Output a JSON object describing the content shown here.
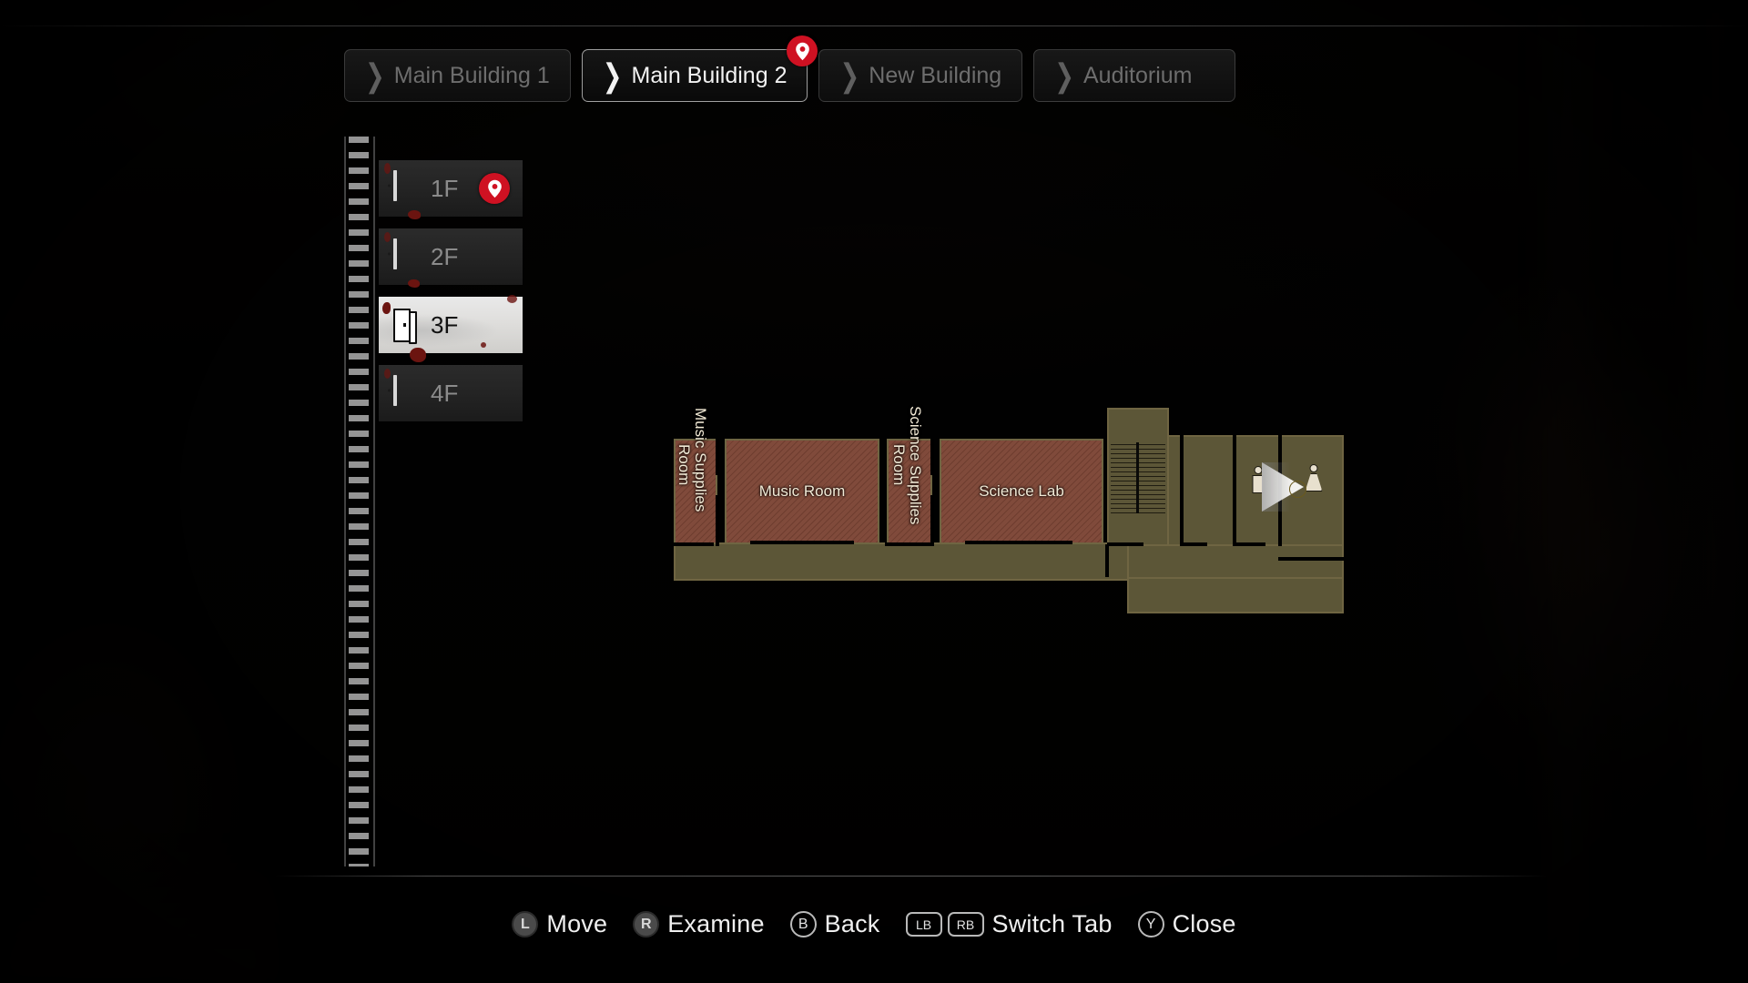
{
  "tabs": [
    {
      "label": "Main Building 1",
      "chevron": "❯",
      "active": false,
      "badge": null
    },
    {
      "label": "Main Building 2",
      "chevron": "❯",
      "active": true,
      "badge": "location-pin"
    },
    {
      "label": "New Building",
      "chevron": "❯",
      "active": false,
      "badge": null
    },
    {
      "label": "Auditorium",
      "chevron": "❯",
      "active": false,
      "badge": null
    }
  ],
  "floors": [
    {
      "label": "1F",
      "icon": "closed-door-icon",
      "selected": false,
      "marker": "location-pin"
    },
    {
      "label": "2F",
      "icon": "closed-door-icon",
      "selected": false,
      "marker": null
    },
    {
      "label": "3F",
      "icon": "open-door-icon",
      "selected": true,
      "marker": null
    },
    {
      "label": "4F",
      "icon": "closed-door-icon",
      "selected": false,
      "marker": null
    }
  ],
  "map": {
    "rooms": [
      {
        "name": "Music Supplies Room",
        "orientation": "vertical",
        "label_line1": "Music Supplies",
        "label_line2": "Room"
      },
      {
        "name": "Music Room",
        "orientation": "horizontal",
        "label": "Music Room"
      },
      {
        "name": "Science Supplies Room",
        "orientation": "vertical",
        "label_line1": "Science Supplies",
        "label_line2": "Room"
      },
      {
        "name": "Science Lab",
        "orientation": "horizontal",
        "label": "Science Lab"
      }
    ],
    "features": [
      {
        "type": "stairs",
        "name": "stairwell"
      },
      {
        "type": "restroom-male",
        "name": "mens-restroom"
      },
      {
        "type": "restroom-female",
        "name": "womens-restroom"
      },
      {
        "type": "player",
        "name": "player-position-marker"
      },
      {
        "type": "item",
        "name": "item-marker"
      }
    ],
    "colors": {
      "room_fill": "#7b4434",
      "corridor_fill": "#5c5637",
      "wall_outline": "#6f6542",
      "label_text": "#f2ead6",
      "item_marker": "#dcc254",
      "pin_badge": "#cf1122"
    }
  },
  "controls": [
    {
      "keys": [
        "L"
      ],
      "key_style": "stick",
      "label": "Move"
    },
    {
      "keys": [
        "R"
      ],
      "key_style": "stick",
      "label": "Examine"
    },
    {
      "keys": [
        "B"
      ],
      "key_style": "round",
      "label": "Back"
    },
    {
      "keys": [
        "LB",
        "RB"
      ],
      "key_style": "bumper",
      "label": "Switch Tab"
    },
    {
      "keys": [
        "Y"
      ],
      "key_style": "round",
      "label": "Close"
    }
  ]
}
